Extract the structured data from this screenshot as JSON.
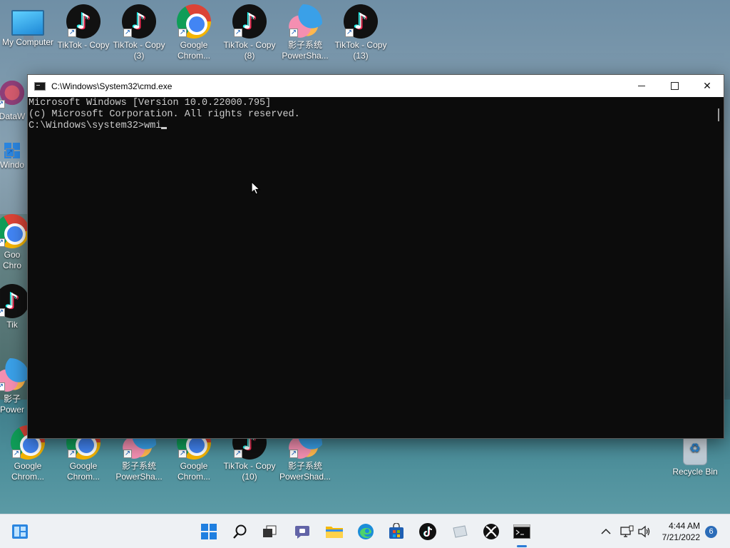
{
  "desktop": {
    "icons_top": [
      {
        "label": "My Computer",
        "type": "computer"
      },
      {
        "label": "TikTok - Copy",
        "type": "tiktok"
      },
      {
        "label": "TikTok - Copy\n(3)",
        "type": "tiktok"
      },
      {
        "label": "Google\nChrom...",
        "type": "chrome"
      },
      {
        "label": "TikTok - Copy\n(8)",
        "type": "tiktok"
      },
      {
        "label": "影子系统\nPowerSha...",
        "type": "shadow"
      },
      {
        "label": "TikTok - Copy\n(13)",
        "type": "tiktok"
      }
    ],
    "icons_left": [
      {
        "label": "DataW",
        "type": "datawin"
      },
      {
        "label": "Windo",
        "type": "win11"
      },
      {
        "label": "Goo\nChro",
        "type": "chrome"
      },
      {
        "label": "Tik",
        "type": "tiktok"
      },
      {
        "label": "影子\nPower",
        "type": "shadow"
      }
    ],
    "icons_bottom": [
      {
        "label": "Google\nChrom...",
        "type": "chrome"
      },
      {
        "label": "Google\nChrom...",
        "type": "chrome"
      },
      {
        "label": "影子系统\nPowerSha...",
        "type": "shadow"
      },
      {
        "label": "Google\nChrom...",
        "type": "chrome"
      },
      {
        "label": "TikTok - Copy\n(10)",
        "type": "tiktok"
      },
      {
        "label": "影子系统\nPowerShad...",
        "type": "shadow"
      }
    ],
    "recycle_bin": {
      "label": "Recycle Bin"
    }
  },
  "cmd_window": {
    "title": "C:\\Windows\\System32\\cmd.exe",
    "lines": [
      "Microsoft Windows [Version 10.0.22000.795]",
      "(c) Microsoft Corporation. All rights reserved.",
      "",
      "C:\\Windows\\system32>wmi"
    ],
    "close_glyph": "✕"
  },
  "taskbar": {
    "widgets_icon": "widgets-icon",
    "apps": [
      {
        "name": "start",
        "icon": "windows-logo-icon"
      },
      {
        "name": "search",
        "icon": "search-icon"
      },
      {
        "name": "task-view",
        "icon": "task-view-icon"
      },
      {
        "name": "chat",
        "icon": "teams-chat-icon"
      },
      {
        "name": "file-explorer",
        "icon": "folder-icon"
      },
      {
        "name": "edge",
        "icon": "edge-icon"
      },
      {
        "name": "store",
        "icon": "store-icon"
      },
      {
        "name": "tiktok",
        "icon": "tiktok-icon"
      },
      {
        "name": "app-blank",
        "icon": "app-icon"
      },
      {
        "name": "xbox",
        "icon": "xbox-icon"
      },
      {
        "name": "cmd",
        "icon": "cmd-icon",
        "active": true
      }
    ],
    "tray": {
      "time": "4:44 AM",
      "date": "7/21/2022",
      "notification_count": "6"
    }
  },
  "colors": {
    "terminal_bg": "#0c0c0c",
    "terminal_fg": "#cccccc",
    "taskbar_bg": "#eef1f4",
    "accent": "#2b7bd6"
  }
}
